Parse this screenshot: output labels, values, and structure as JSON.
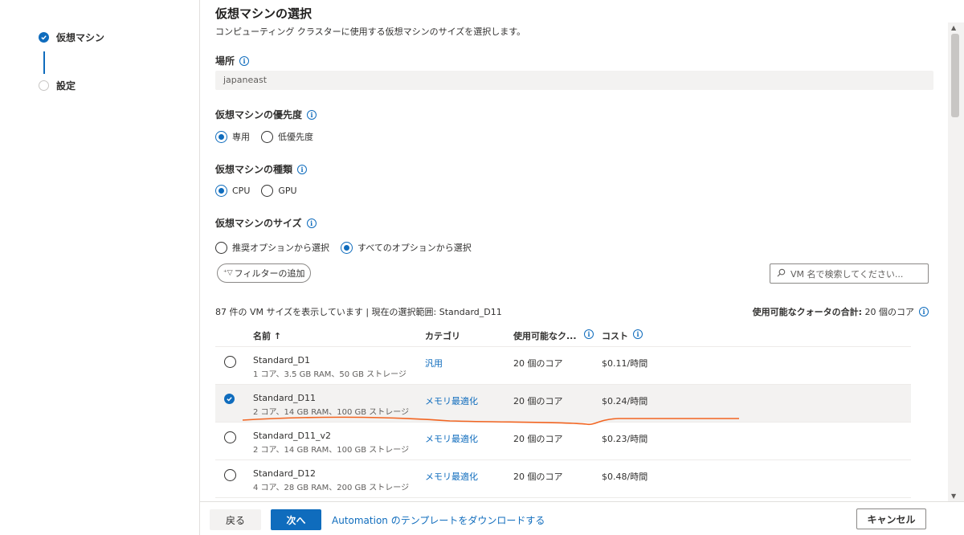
{
  "wizard": {
    "steps": [
      {
        "label": "仮想マシン",
        "state": "done"
      },
      {
        "label": "設定",
        "state": "todo"
      }
    ]
  },
  "main": {
    "title": "仮想マシンの選択",
    "description": "コンピューティング クラスターに使用する仮想マシンのサイズを選択します。",
    "location_label": "場所",
    "location_value": "japaneast",
    "priority_label": "仮想マシンの優先度",
    "priority_options": [
      "専用",
      "低優先度"
    ],
    "priority_selected": "専用",
    "type_label": "仮想マシンの種類",
    "type_options": [
      "CPU",
      "GPU"
    ],
    "type_selected": "CPU",
    "size_label": "仮想マシンのサイズ",
    "size_options": [
      "推奨オプションから選択",
      "すべてのオプションから選択"
    ],
    "size_selected": "すべてのオプションから選択",
    "filter_button": "フィルターの追加",
    "search_placeholder": "VM 名で検索してください...",
    "summary": "87 件の VM サイズを表示しています | 現在の選択範囲: Standard_D11",
    "quota_label": "使用可能なクォータの合計:",
    "quota_value": "20 個のコア"
  },
  "table": {
    "headers": {
      "name": "名前 ↑",
      "category": "カテゴリ",
      "available": "使用可能なク...",
      "cost": "コスト"
    },
    "rows": [
      {
        "name": "Standard_D1",
        "detail": "1 コア、3.5 GB RAM、50 GB ストレージ",
        "category": "汎用",
        "available": "20 個のコア",
        "cost": "$0.11/時間",
        "selected": false
      },
      {
        "name": "Standard_D11",
        "detail": "2 コア、14 GB RAM、100 GB ストレージ",
        "category": "メモリ最適化",
        "available": "20 個のコア",
        "cost": "$0.24/時間",
        "selected": true
      },
      {
        "name": "Standard_D11_v2",
        "detail": "2 コア、14 GB RAM、100 GB ストレージ",
        "category": "メモリ最適化",
        "available": "20 個のコア",
        "cost": "$0.23/時間",
        "selected": false
      },
      {
        "name": "Standard_D12",
        "detail": "4 コア、28 GB RAM、200 GB ストレージ",
        "category": "メモリ最適化",
        "available": "20 個のコア",
        "cost": "$0.48/時間",
        "selected": false
      }
    ]
  },
  "footer": {
    "back": "戻る",
    "next": "次へ",
    "download_link": "Automation のテンプレートをダウンロードする",
    "cancel": "キャンセル"
  },
  "colors": {
    "accent": "#0f6cbd",
    "annotation": "#f26522"
  }
}
